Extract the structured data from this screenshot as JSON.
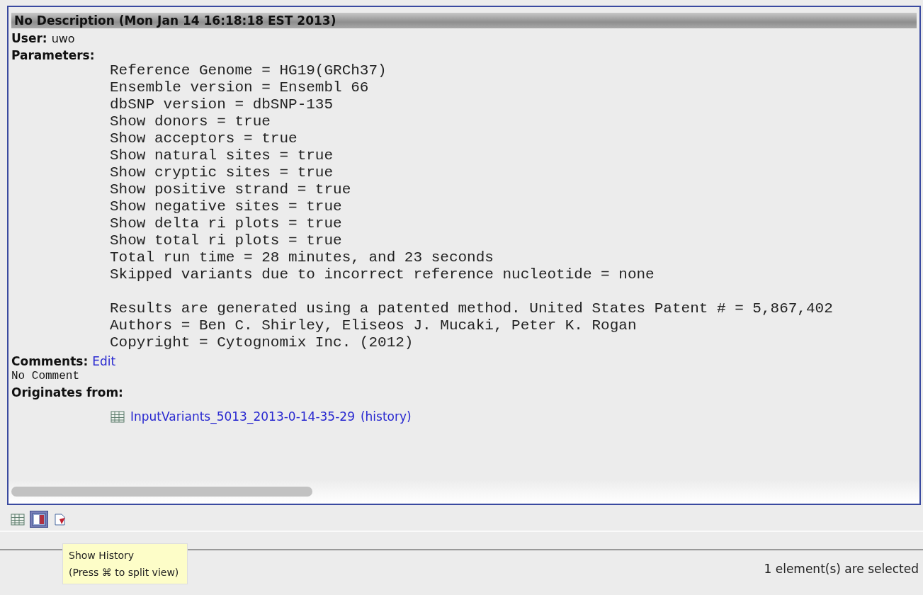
{
  "header": {
    "title": "No Description (Mon Jan 14 16:18:18 EST 2013)"
  },
  "user": {
    "label": "User:",
    "value": "uwo"
  },
  "parameters": {
    "label": "Parameters:",
    "groups": [
      [
        "Reference Genome = HG19(GRCh37)",
        "Ensemble version = Ensembl 66",
        "dbSNP version = dbSNP-135",
        "Show donors = true",
        "Show acceptors = true",
        "Show natural sites = true",
        "Show cryptic sites = true",
        "Show positive strand = true",
        "Show negative sites = true",
        "Show delta ri plots = true",
        "Show total ri plots = true",
        "Total run time = 28 minutes, and 23 seconds",
        "Skipped variants due to incorrect reference nucleotide = none"
      ],
      [
        "Results are generated using a patented method. United States Patent # = 5,867,402",
        "Authors = Ben C. Shirley, Eliseos J. Mucaki, Peter K. Rogan",
        "Copyright = Cytognomix Inc. (2012)"
      ]
    ]
  },
  "comments": {
    "label": "Comments:",
    "edit_link": "Edit",
    "text": "No Comment"
  },
  "originates": {
    "label": "Originates from:",
    "source": {
      "name": "InputVariants_5013_2013-0-14-35-29",
      "history_link": "(history)"
    }
  },
  "toolbar": [
    {
      "kind": "table",
      "selected": false
    },
    {
      "kind": "book",
      "selected": true
    },
    {
      "kind": "check",
      "selected": false
    }
  ],
  "tooltip": {
    "lines": [
      "Show History",
      "(Press ⌘ to split view)"
    ]
  },
  "status_bar": {
    "text": "1 element(s) are selected"
  }
}
